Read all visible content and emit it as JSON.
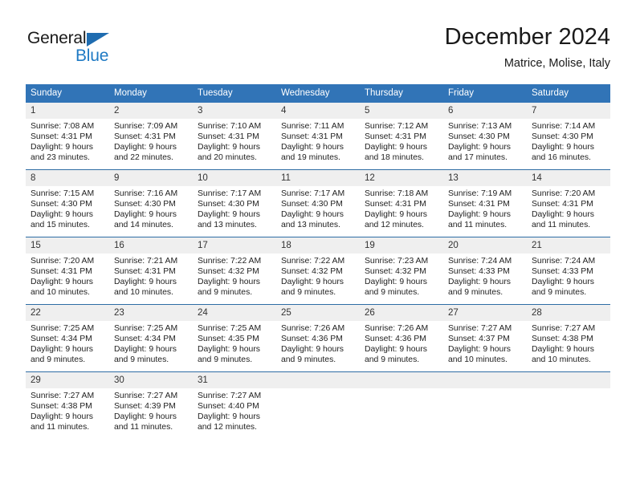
{
  "brand": {
    "name_part1": "General",
    "name_part2": "Blue",
    "accent_color": "#1f7ac4",
    "triangle_color": "#1f6cb0"
  },
  "header": {
    "title": "December 2024",
    "subtitle": "Matrice, Molise, Italy"
  },
  "theme": {
    "header_bg": "#3174b7",
    "header_text": "#ffffff",
    "daynum_bg": "#efefef",
    "row_divider": "#2e6da4"
  },
  "calendar": {
    "weekday_headers": [
      "Sunday",
      "Monday",
      "Tuesday",
      "Wednesday",
      "Thursday",
      "Friday",
      "Saturday"
    ],
    "weeks": [
      [
        {
          "day": "1",
          "sunrise": "Sunrise: 7:08 AM",
          "sunset": "Sunset: 4:31 PM",
          "daylight1": "Daylight: 9 hours",
          "daylight2": "and 23 minutes."
        },
        {
          "day": "2",
          "sunrise": "Sunrise: 7:09 AM",
          "sunset": "Sunset: 4:31 PM",
          "daylight1": "Daylight: 9 hours",
          "daylight2": "and 22 minutes."
        },
        {
          "day": "3",
          "sunrise": "Sunrise: 7:10 AM",
          "sunset": "Sunset: 4:31 PM",
          "daylight1": "Daylight: 9 hours",
          "daylight2": "and 20 minutes."
        },
        {
          "day": "4",
          "sunrise": "Sunrise: 7:11 AM",
          "sunset": "Sunset: 4:31 PM",
          "daylight1": "Daylight: 9 hours",
          "daylight2": "and 19 minutes."
        },
        {
          "day": "5",
          "sunrise": "Sunrise: 7:12 AM",
          "sunset": "Sunset: 4:31 PM",
          "daylight1": "Daylight: 9 hours",
          "daylight2": "and 18 minutes."
        },
        {
          "day": "6",
          "sunrise": "Sunrise: 7:13 AM",
          "sunset": "Sunset: 4:30 PM",
          "daylight1": "Daylight: 9 hours",
          "daylight2": "and 17 minutes."
        },
        {
          "day": "7",
          "sunrise": "Sunrise: 7:14 AM",
          "sunset": "Sunset: 4:30 PM",
          "daylight1": "Daylight: 9 hours",
          "daylight2": "and 16 minutes."
        }
      ],
      [
        {
          "day": "8",
          "sunrise": "Sunrise: 7:15 AM",
          "sunset": "Sunset: 4:30 PM",
          "daylight1": "Daylight: 9 hours",
          "daylight2": "and 15 minutes."
        },
        {
          "day": "9",
          "sunrise": "Sunrise: 7:16 AM",
          "sunset": "Sunset: 4:30 PM",
          "daylight1": "Daylight: 9 hours",
          "daylight2": "and 14 minutes."
        },
        {
          "day": "10",
          "sunrise": "Sunrise: 7:17 AM",
          "sunset": "Sunset: 4:30 PM",
          "daylight1": "Daylight: 9 hours",
          "daylight2": "and 13 minutes."
        },
        {
          "day": "11",
          "sunrise": "Sunrise: 7:17 AM",
          "sunset": "Sunset: 4:30 PM",
          "daylight1": "Daylight: 9 hours",
          "daylight2": "and 13 minutes."
        },
        {
          "day": "12",
          "sunrise": "Sunrise: 7:18 AM",
          "sunset": "Sunset: 4:31 PM",
          "daylight1": "Daylight: 9 hours",
          "daylight2": "and 12 minutes."
        },
        {
          "day": "13",
          "sunrise": "Sunrise: 7:19 AM",
          "sunset": "Sunset: 4:31 PM",
          "daylight1": "Daylight: 9 hours",
          "daylight2": "and 11 minutes."
        },
        {
          "day": "14",
          "sunrise": "Sunrise: 7:20 AM",
          "sunset": "Sunset: 4:31 PM",
          "daylight1": "Daylight: 9 hours",
          "daylight2": "and 11 minutes."
        }
      ],
      [
        {
          "day": "15",
          "sunrise": "Sunrise: 7:20 AM",
          "sunset": "Sunset: 4:31 PM",
          "daylight1": "Daylight: 9 hours",
          "daylight2": "and 10 minutes."
        },
        {
          "day": "16",
          "sunrise": "Sunrise: 7:21 AM",
          "sunset": "Sunset: 4:31 PM",
          "daylight1": "Daylight: 9 hours",
          "daylight2": "and 10 minutes."
        },
        {
          "day": "17",
          "sunrise": "Sunrise: 7:22 AM",
          "sunset": "Sunset: 4:32 PM",
          "daylight1": "Daylight: 9 hours",
          "daylight2": "and 9 minutes."
        },
        {
          "day": "18",
          "sunrise": "Sunrise: 7:22 AM",
          "sunset": "Sunset: 4:32 PM",
          "daylight1": "Daylight: 9 hours",
          "daylight2": "and 9 minutes."
        },
        {
          "day": "19",
          "sunrise": "Sunrise: 7:23 AM",
          "sunset": "Sunset: 4:32 PM",
          "daylight1": "Daylight: 9 hours",
          "daylight2": "and 9 minutes."
        },
        {
          "day": "20",
          "sunrise": "Sunrise: 7:24 AM",
          "sunset": "Sunset: 4:33 PM",
          "daylight1": "Daylight: 9 hours",
          "daylight2": "and 9 minutes."
        },
        {
          "day": "21",
          "sunrise": "Sunrise: 7:24 AM",
          "sunset": "Sunset: 4:33 PM",
          "daylight1": "Daylight: 9 hours",
          "daylight2": "and 9 minutes."
        }
      ],
      [
        {
          "day": "22",
          "sunrise": "Sunrise: 7:25 AM",
          "sunset": "Sunset: 4:34 PM",
          "daylight1": "Daylight: 9 hours",
          "daylight2": "and 9 minutes."
        },
        {
          "day": "23",
          "sunrise": "Sunrise: 7:25 AM",
          "sunset": "Sunset: 4:34 PM",
          "daylight1": "Daylight: 9 hours",
          "daylight2": "and 9 minutes."
        },
        {
          "day": "24",
          "sunrise": "Sunrise: 7:25 AM",
          "sunset": "Sunset: 4:35 PM",
          "daylight1": "Daylight: 9 hours",
          "daylight2": "and 9 minutes."
        },
        {
          "day": "25",
          "sunrise": "Sunrise: 7:26 AM",
          "sunset": "Sunset: 4:36 PM",
          "daylight1": "Daylight: 9 hours",
          "daylight2": "and 9 minutes."
        },
        {
          "day": "26",
          "sunrise": "Sunrise: 7:26 AM",
          "sunset": "Sunset: 4:36 PM",
          "daylight1": "Daylight: 9 hours",
          "daylight2": "and 9 minutes."
        },
        {
          "day": "27",
          "sunrise": "Sunrise: 7:27 AM",
          "sunset": "Sunset: 4:37 PM",
          "daylight1": "Daylight: 9 hours",
          "daylight2": "and 10 minutes."
        },
        {
          "day": "28",
          "sunrise": "Sunrise: 7:27 AM",
          "sunset": "Sunset: 4:38 PM",
          "daylight1": "Daylight: 9 hours",
          "daylight2": "and 10 minutes."
        }
      ],
      [
        {
          "day": "29",
          "sunrise": "Sunrise: 7:27 AM",
          "sunset": "Sunset: 4:38 PM",
          "daylight1": "Daylight: 9 hours",
          "daylight2": "and 11 minutes."
        },
        {
          "day": "30",
          "sunrise": "Sunrise: 7:27 AM",
          "sunset": "Sunset: 4:39 PM",
          "daylight1": "Daylight: 9 hours",
          "daylight2": "and 11 minutes."
        },
        {
          "day": "31",
          "sunrise": "Sunrise: 7:27 AM",
          "sunset": "Sunset: 4:40 PM",
          "daylight1": "Daylight: 9 hours",
          "daylight2": "and 12 minutes."
        },
        {
          "day": "",
          "sunrise": "",
          "sunset": "",
          "daylight1": "",
          "daylight2": "",
          "empty": true
        },
        {
          "day": "",
          "sunrise": "",
          "sunset": "",
          "daylight1": "",
          "daylight2": "",
          "empty": true
        },
        {
          "day": "",
          "sunrise": "",
          "sunset": "",
          "daylight1": "",
          "daylight2": "",
          "empty": true
        },
        {
          "day": "",
          "sunrise": "",
          "sunset": "",
          "daylight1": "",
          "daylight2": "",
          "empty": true
        }
      ]
    ]
  }
}
